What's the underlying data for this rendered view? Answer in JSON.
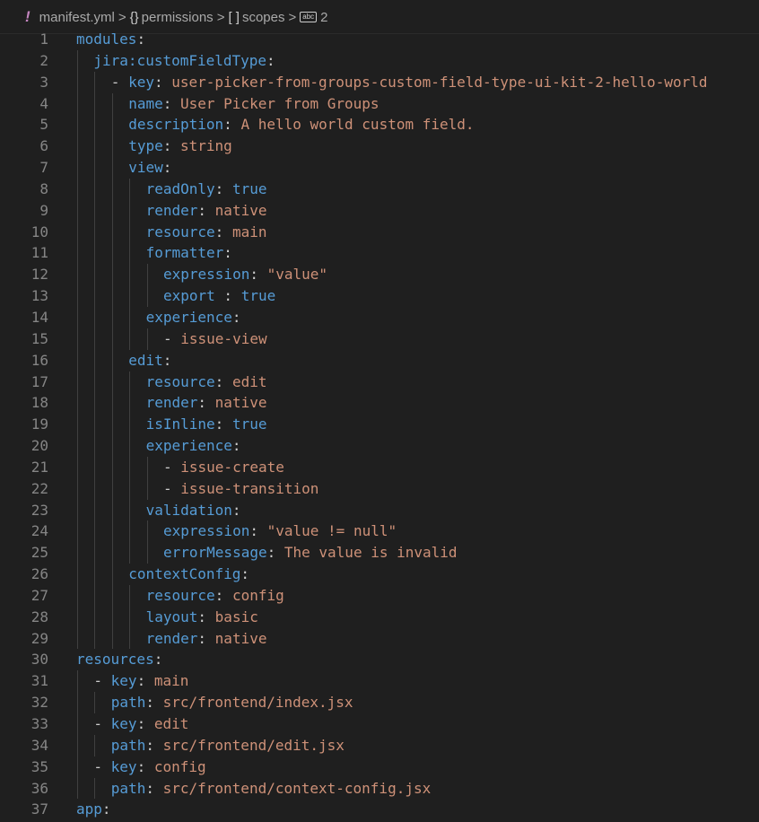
{
  "breadcrumb": {
    "file_icon": "!",
    "file": "manifest.yml",
    "item2_icon": "{}",
    "item2": "permissions",
    "item3_icon": "[ ]",
    "item3": "scopes",
    "item4_icon": "abc",
    "item4": "2",
    "separator": ">"
  },
  "colors": {
    "background": "#1f1f1f",
    "key": "#569cd6",
    "string": "#ce9178",
    "punct": "#cccccc",
    "line_number": "#858585"
  },
  "lines": [
    {
      "n": "1",
      "indent": 0,
      "dash": false,
      "key": "modules",
      "sep": ":",
      "val": ""
    },
    {
      "n": "2",
      "indent": 1,
      "dash": false,
      "key": "jira:customFieldType",
      "sep": ":",
      "val": ""
    },
    {
      "n": "3",
      "indent": 2,
      "dash": true,
      "key": "key",
      "sep": ":",
      "val": "user-picker-from-groups-custom-field-type-ui-kit-2-hello-world"
    },
    {
      "n": "4",
      "indent": 3,
      "dash": false,
      "key": "name",
      "sep": ":",
      "val": "User Picker from Groups"
    },
    {
      "n": "5",
      "indent": 3,
      "dash": false,
      "key": "description",
      "sep": ":",
      "val": "A hello world custom field."
    },
    {
      "n": "6",
      "indent": 3,
      "dash": false,
      "key": "type",
      "sep": ":",
      "val": "string"
    },
    {
      "n": "7",
      "indent": 3,
      "dash": false,
      "key": "view",
      "sep": ":",
      "val": ""
    },
    {
      "n": "8",
      "indent": 4,
      "dash": false,
      "key": "readOnly",
      "sep": ":",
      "val": "true",
      "vtype": "k"
    },
    {
      "n": "9",
      "indent": 4,
      "dash": false,
      "key": "render",
      "sep": ":",
      "val": "native"
    },
    {
      "n": "10",
      "indent": 4,
      "dash": false,
      "key": "resource",
      "sep": ":",
      "val": "main"
    },
    {
      "n": "11",
      "indent": 4,
      "dash": false,
      "key": "formatter",
      "sep": ":",
      "val": ""
    },
    {
      "n": "12",
      "indent": 5,
      "dash": false,
      "key": "expression",
      "sep": ":",
      "val": "\"value\""
    },
    {
      "n": "13",
      "indent": 5,
      "dash": false,
      "key": "export",
      "sep": " :",
      "val": "true",
      "vtype": "k"
    },
    {
      "n": "14",
      "indent": 4,
      "dash": false,
      "key": "experience",
      "sep": ":",
      "val": ""
    },
    {
      "n": "15",
      "indent": 5,
      "dash": true,
      "key": "",
      "sep": "",
      "val": "issue-view"
    },
    {
      "n": "16",
      "indent": 3,
      "dash": false,
      "key": "edit",
      "sep": ":",
      "val": ""
    },
    {
      "n": "17",
      "indent": 4,
      "dash": false,
      "key": "resource",
      "sep": ":",
      "val": "edit"
    },
    {
      "n": "18",
      "indent": 4,
      "dash": false,
      "key": "render",
      "sep": ":",
      "val": "native"
    },
    {
      "n": "19",
      "indent": 4,
      "dash": false,
      "key": "isInline",
      "sep": ":",
      "val": "true",
      "vtype": "k"
    },
    {
      "n": "20",
      "indent": 4,
      "dash": false,
      "key": "experience",
      "sep": ":",
      "val": ""
    },
    {
      "n": "21",
      "indent": 5,
      "dash": true,
      "key": "",
      "sep": "",
      "val": "issue-create"
    },
    {
      "n": "22",
      "indent": 5,
      "dash": true,
      "key": "",
      "sep": "",
      "val": "issue-transition"
    },
    {
      "n": "23",
      "indent": 4,
      "dash": false,
      "key": "validation",
      "sep": ":",
      "val": ""
    },
    {
      "n": "24",
      "indent": 5,
      "dash": false,
      "key": "expression",
      "sep": ":",
      "val": "\"value != null\""
    },
    {
      "n": "25",
      "indent": 5,
      "dash": false,
      "key": "errorMessage",
      "sep": ":",
      "val": "The value is invalid"
    },
    {
      "n": "26",
      "indent": 3,
      "dash": false,
      "key": "contextConfig",
      "sep": ":",
      "val": ""
    },
    {
      "n": "27",
      "indent": 4,
      "dash": false,
      "key": "resource",
      "sep": ":",
      "val": "config"
    },
    {
      "n": "28",
      "indent": 4,
      "dash": false,
      "key": "layout",
      "sep": ":",
      "val": "basic"
    },
    {
      "n": "29",
      "indent": 4,
      "dash": false,
      "key": "render",
      "sep": ":",
      "val": "native"
    },
    {
      "n": "30",
      "indent": 0,
      "dash": false,
      "key": "resources",
      "sep": ":",
      "val": ""
    },
    {
      "n": "31",
      "indent": 1,
      "dash": true,
      "key": "key",
      "sep": ":",
      "val": "main"
    },
    {
      "n": "32",
      "indent": 2,
      "dash": false,
      "key": "path",
      "sep": ":",
      "val": "src/frontend/index.jsx"
    },
    {
      "n": "33",
      "indent": 1,
      "dash": true,
      "key": "key",
      "sep": ":",
      "val": "edit"
    },
    {
      "n": "34",
      "indent": 2,
      "dash": false,
      "key": "path",
      "sep": ":",
      "val": "src/frontend/edit.jsx"
    },
    {
      "n": "35",
      "indent": 1,
      "dash": true,
      "key": "key",
      "sep": ":",
      "val": "config"
    },
    {
      "n": "36",
      "indent": 2,
      "dash": false,
      "key": "path",
      "sep": ":",
      "val": "src/frontend/context-config.jsx"
    },
    {
      "n": "37",
      "indent": 0,
      "dash": false,
      "key": "app",
      "sep": ":",
      "val": ""
    }
  ]
}
